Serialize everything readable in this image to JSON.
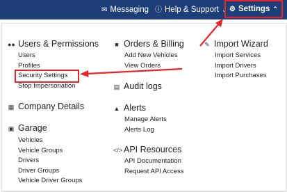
{
  "nav": {
    "messaging": {
      "label": "Messaging",
      "icon": "envelope-icon"
    },
    "help": {
      "label": "Help & Support",
      "icon": "question-circle-icon"
    },
    "settings": {
      "label": "Settings",
      "icon": "gear-icon"
    }
  },
  "menu": {
    "users": {
      "title": "Users & Permissions",
      "icon": "users-icon",
      "links": [
        "Users",
        "Profiles",
        "Security Settings",
        "Stop Impersonation"
      ]
    },
    "company": {
      "title": "Company Details",
      "icon": "building-icon"
    },
    "garage": {
      "title": "Garage",
      "icon": "car-icon",
      "links": [
        "Vehicles",
        "Vehicle Groups",
        "Drivers",
        "Driver Groups",
        "Vehicle Driver Groups"
      ]
    },
    "orders": {
      "title": "Orders & Billing",
      "icon": "lock-icon",
      "links": [
        "Add New Vehicles",
        "View Orders"
      ]
    },
    "audit": {
      "title": "Audit logs",
      "icon": "document-icon"
    },
    "alerts": {
      "title": "Alerts",
      "icon": "warning-icon",
      "links": [
        "Manage Alerts",
        "Alerts Log"
      ]
    },
    "api": {
      "title": "API Resources",
      "icon": "code-icon",
      "links": [
        "API Documentation",
        "Request API Access"
      ]
    },
    "import": {
      "title": "Import Wizard",
      "icon": "edit-icon",
      "links": [
        "Import Services",
        "Import Drivers",
        "Import Purchases"
      ]
    }
  },
  "colors": {
    "topbar": "#1e3e78",
    "annotation": "#e8242a"
  }
}
